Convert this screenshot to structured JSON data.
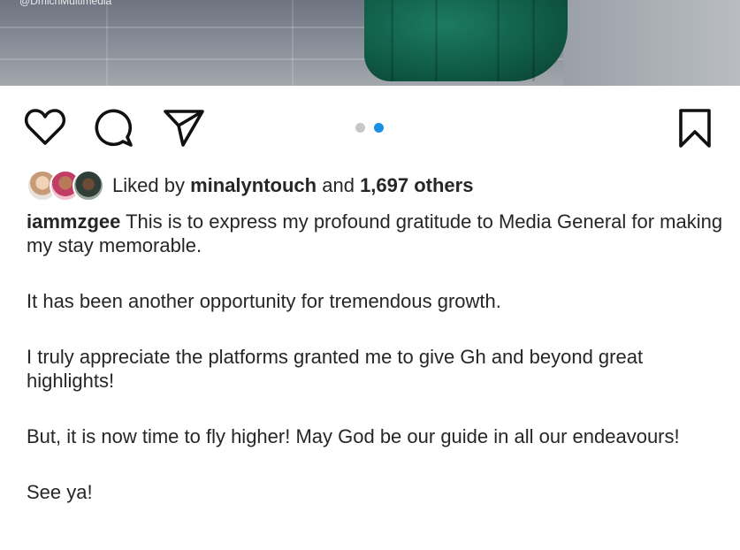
{
  "photo": {
    "credit": "@DmichMultimedia"
  },
  "actions": {
    "like_icon": "heart-icon",
    "comment_icon": "comment-icon",
    "share_icon": "paper-plane-icon",
    "save_icon": "bookmark-icon",
    "carousel": {
      "total": 2,
      "active": 2,
      "active_color": "#1a8fe3",
      "inactive_color": "#c7c7c7"
    }
  },
  "likes": {
    "prefix": "Liked by",
    "user": "minalyntouch",
    "middle": "and",
    "others": "1,697 others"
  },
  "caption": {
    "username": "iammzgee",
    "first": "This is to express my profound gratitude to Media General for making my stay memorable.",
    "paragraphs": [
      "It has been another opportunity for tremendous growth.",
      "I truly appreciate the platforms granted me to give Gh and beyond great highlights!",
      "But, it is now time to fly higher! May God be our guide in all our endeavours!",
      "See ya!"
    ]
  }
}
